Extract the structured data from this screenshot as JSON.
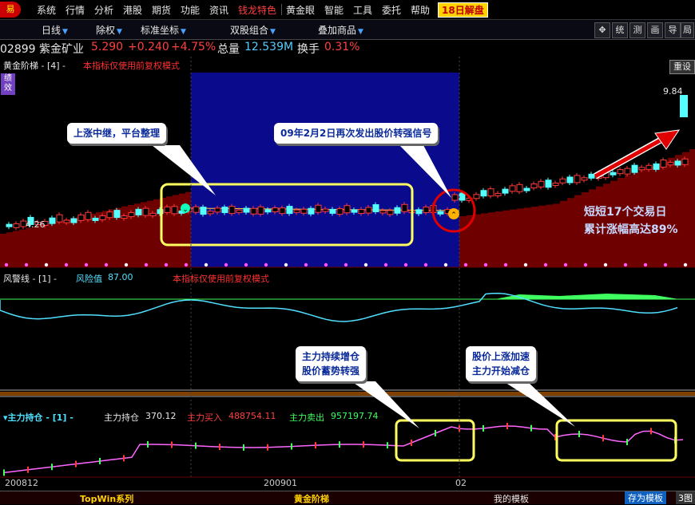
{
  "menu": {
    "logo": "易",
    "items": [
      "系统",
      "行情",
      "分析",
      "港股",
      "期货",
      "功能",
      "资讯"
    ],
    "special": "钱龙特色",
    "items2": [
      "黄金眼",
      "智能",
      "工具",
      "委托",
      "帮助"
    ],
    "badge": "18日解盘"
  },
  "toolbar": {
    "items": [
      "日线",
      "除权",
      "标准坐标",
      "双股组合",
      "叠加商品"
    ],
    "buttons": [
      "✥",
      "统",
      "测",
      "画",
      "导",
      "局"
    ]
  },
  "quote": {
    "code_name": "02899 紫金矿业",
    "price": "5.290",
    "change": "+0.240",
    "pct": "+4.75%",
    "volume_label": "总量",
    "volume": "12.539M",
    "turnover_label": "换手",
    "turnover": "0.31%"
  },
  "panel1": {
    "title": "黄金阶梯 - [4] -",
    "note": "本指标仅使用前复权模式",
    "reset": "重设",
    "side_tag": "绩效",
    "low_label": "4.26",
    "high_label": "9.84",
    "callout1": "上涨中继，平台整理",
    "callout2": "09年2月2日再次发出股价转强信号",
    "annotation_line1": "短短17个交易日",
    "annotation_line2": "累计涨幅高达89%"
  },
  "panel2": {
    "title": "风警线 - [1] -",
    "risk_label": "风险值",
    "risk_value": "87.00",
    "note": "本指标仅使用前复权模式"
  },
  "panel3": {
    "title": "▾主力持仓 - [1] -",
    "hold_label": "主力持仓",
    "hold_value": "370.12",
    "buy_label": "主力买入",
    "buy_value": "488754.11",
    "sell_label": "主力卖出",
    "sell_value": "957197.74",
    "callout1_line1": "主力持续增仓",
    "callout1_line2": "股价蓄势转强",
    "callout2_line1": "股价上涨加速",
    "callout2_line2": "主力开始减仓"
  },
  "axis": {
    "d1": "200812",
    "d2": "200901",
    "d3": "02"
  },
  "bottom": {
    "tab1": "TopWin系列",
    "tab2": "黄金阶梯",
    "tab3": "我的模板",
    "save": "存为模板",
    "graphs": "3图"
  },
  "colors": {
    "up": "#ff3a3a",
    "down": "#54ffff",
    "ladder": "#6e0000",
    "blue_zone": "#0a0a8c",
    "yellow_box": "#ffff60",
    "risk_line": "#50e0ff",
    "hold_line": "#ff66ff"
  }
}
